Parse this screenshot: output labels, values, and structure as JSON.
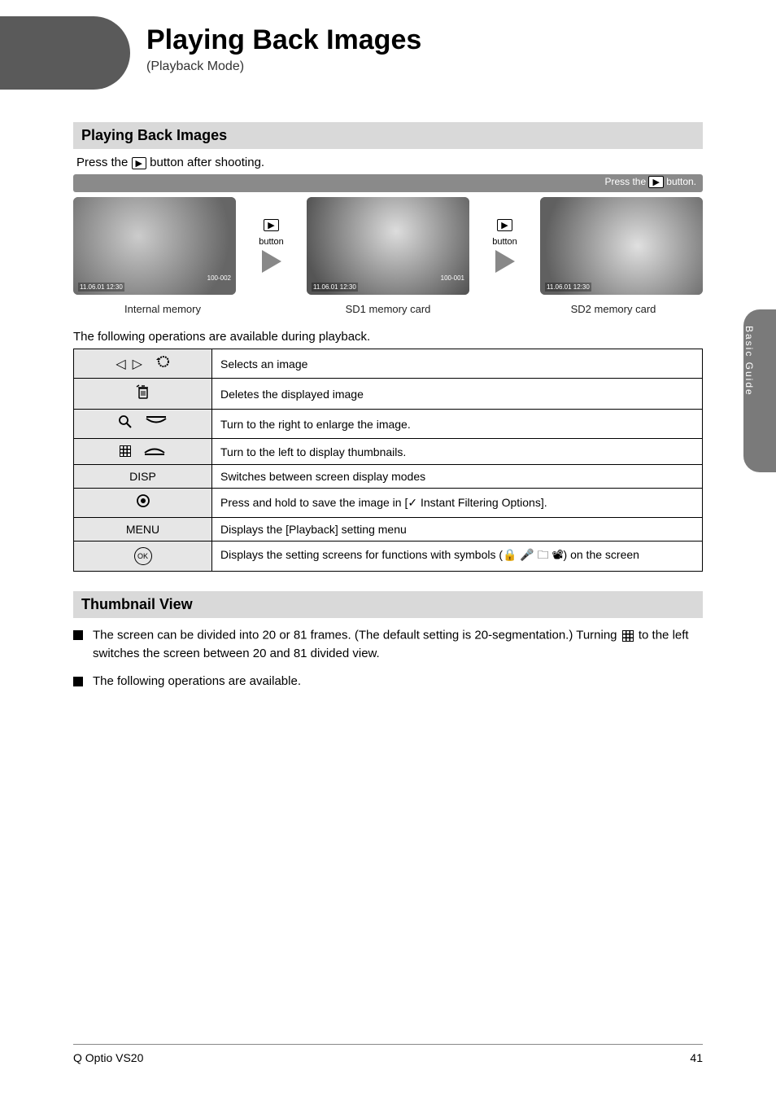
{
  "header": {
    "title": "Playing Back Images",
    "subtitle": "(Playback Mode)"
  },
  "side_tab": "Basic Guide",
  "section1": {
    "title": "Playing Back Images",
    "line1_pre": "Press the ",
    "line1_post": " button after shooting."
  },
  "dotted_bar_right": {
    "label_pre": "Press the ",
    "label_post": " button."
  },
  "thumbs": {
    "between_label": "button",
    "captions": [
      "Internal memory",
      "SD1 memory card",
      "SD2 memory card"
    ],
    "timestamp": "11.06.01 12:30",
    "folders": [
      "100-002",
      "100-001",
      ""
    ]
  },
  "table": {
    "intro": "The following operations are available during playback.",
    "rows": [
      {
        "left_icons": "◁ ▷   ⟲",
        "right": "Selects an image"
      },
      {
        "left_icons": "trash",
        "right": "Deletes the displayed image"
      },
      {
        "left_icons": "Q  ▽",
        "right": "Turn to the right to enlarge the image."
      },
      {
        "left_icons": "grid  ▽",
        "right": "Turn to the left to display thumbnails."
      },
      {
        "left_text": "DISP",
        "right": "Switches between screen display modes"
      },
      {
        "left_icons": "◉",
        "right_pre": "Press and hold to save the image in [✓ Instant Filtering Options]."
      },
      {
        "left_text": "MENU",
        "right": "Displays the [Playback] setting menu"
      },
      {
        "left_icons": "OK",
        "right_pre": "Displays the setting screens for functions with symbols (🔒 🎤 🗀 📽) on the screen"
      }
    ]
  },
  "section2": {
    "title": "Thumbnail View",
    "bullets": [
      {
        "text_pre": "The screen can be divided into 20 or 81 frames. (The default setting is 20-segmentation.) Turning ",
        "icon": "grid",
        "text_post": " to the left switches the screen between 20 and 81 divided view."
      },
      {
        "text": "The following operations are available."
      }
    ]
  },
  "footer": {
    "left": "Q Optio VS20",
    "right": "41"
  }
}
